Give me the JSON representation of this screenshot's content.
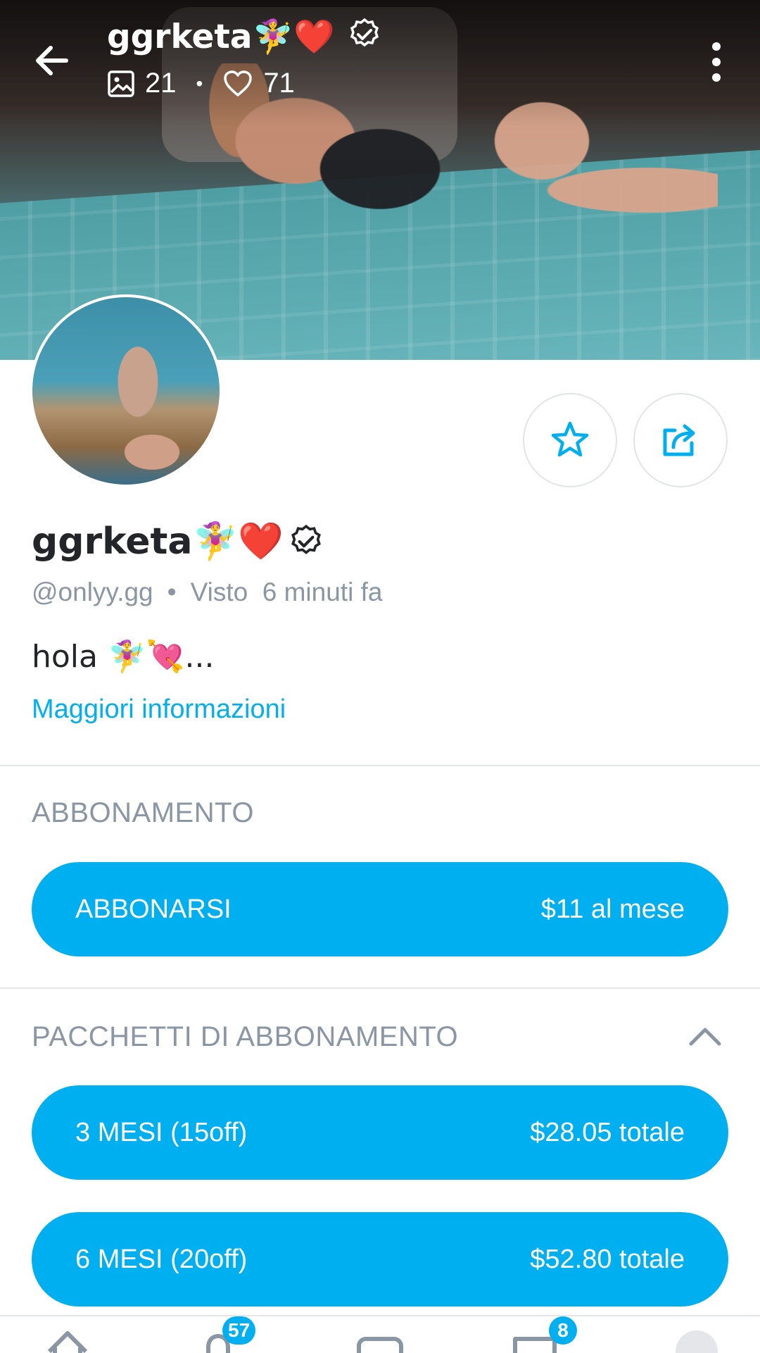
{
  "header": {
    "title": "ggrketa🧚‍♀️❤️",
    "photos_count": "21",
    "likes_count": "71"
  },
  "profile": {
    "display_name": "ggrketa🧚‍♀️❤️",
    "handle": "@onlyy.gg",
    "separator": "•",
    "last_seen_label": "Visto",
    "last_seen_value": "6 minuti fa",
    "bio": "hola 🧚‍♀️💘...",
    "more_info_link": "Maggiori informazioni"
  },
  "subscription": {
    "section_title": "ABBONAMENTO",
    "button_label": "ABBONARSI",
    "button_price": "$11 al mese"
  },
  "bundles": {
    "section_title": "PACCHETTI DI ABBONAMENTO",
    "items": [
      {
        "label": "3 MESI (15off)",
        "price": "$28.05 totale"
      },
      {
        "label": "6 MESI (20off)",
        "price": "$52.80 totale"
      }
    ]
  },
  "bottom_nav": {
    "notifications_badge": "57",
    "messages_badge": "8"
  },
  "colors": {
    "accent": "#00aff0",
    "muted_text": "#8a96a3",
    "divider": "#e4e6ea"
  }
}
